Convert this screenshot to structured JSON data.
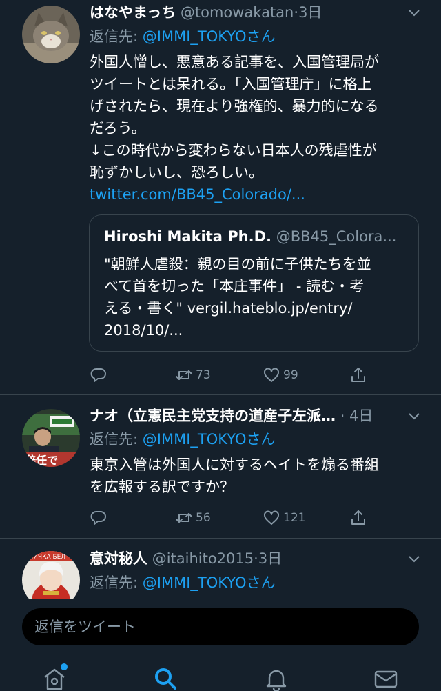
{
  "colors": {
    "background": "#15202b",
    "accent": "#1da1f2",
    "muted": "#8899a6",
    "divider": "#38444d"
  },
  "tweets": [
    {
      "name": "はなやまっち",
      "handle": "@tomowakatan",
      "time": "3日",
      "reply_label": "返信先: ",
      "reply_to": "@IMMI_TOKYOさん",
      "body_lines": [
        "外国人憎し、悪意ある記事を、入国管理局が",
        "ツイートとは呆れる。「入国管理庁」に格上",
        "げされたら、現在より強権的、暴力的になる",
        "だろう。",
        "↓この時代から変わらない日本人の残虐性が",
        "恥ずかしいし、恐ろしい。"
      ],
      "link": "twitter.com/BB45_Colorado/...",
      "quote": {
        "name": "Hiroshi Makita Ph.D.",
        "handle": "@BB45_Colora...",
        "lines": [
          "\"朝鮮人虐殺：親の目の前に子供たちを並",
          "べて首を切った「本庄事件」 - 読む・考",
          "える・書く\" vergil.hateblo.jp/entry/",
          "2018/10/..."
        ]
      },
      "retweets": "73",
      "likes": "99"
    },
    {
      "name": "ナオ（立憲民主党支持の道産子左派…",
      "handle": "",
      "time": "4日",
      "reply_label": "返信先: ",
      "reply_to": "@IMMI_TOKYOさん",
      "body_lines": [
        "東京入管は外国人に対するヘイトを煽る番組",
        "を広報する訳ですか？"
      ],
      "retweets": "56",
      "likes": "121"
    },
    {
      "name": "意対秘人",
      "handle": "@itaihito2015",
      "time": "3日",
      "reply_label": "返信先: ",
      "reply_to": "@IMMI_TOKYOさん"
    }
  ],
  "composer": {
    "placeholder": "返信をツイート"
  },
  "icons": [
    "chevron-down-icon",
    "reply-icon",
    "retweet-icon",
    "like-icon",
    "share-icon",
    "home-icon",
    "search-icon",
    "notifications-icon",
    "messages-icon"
  ]
}
